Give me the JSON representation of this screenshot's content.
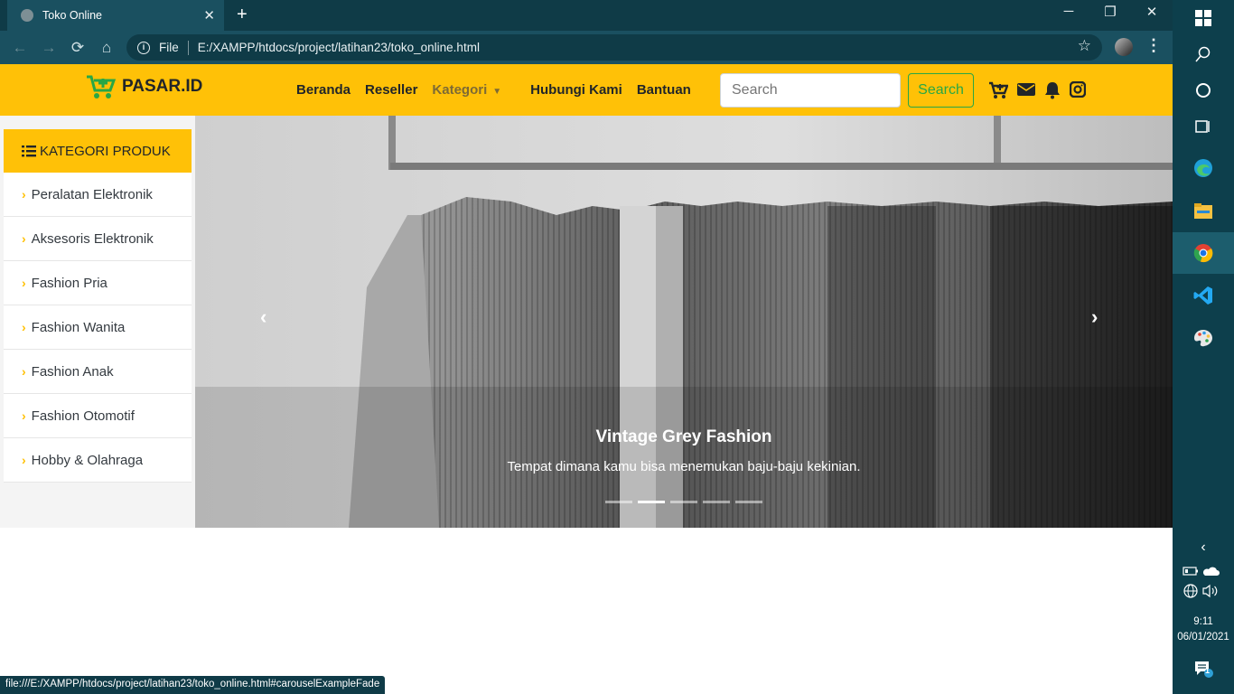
{
  "browser": {
    "tab_title": "Toko Online",
    "tab_close": "✕",
    "new_tab": "+",
    "window_controls": {
      "minimize": "─",
      "restore": "❐",
      "close": "✕"
    },
    "file_label": "File",
    "url": "E:/XAMPP/htdocs/project/latihan23/toko_online.html",
    "status_url": "file:///E:/XAMPP/htdocs/project/latihan23/toko_online.html#carouselExampleFade"
  },
  "navbar": {
    "brand": "PASAR.ID",
    "menu": [
      "Beranda",
      "Reseller",
      "Kategori",
      "Hubungi Kami",
      "Bantuan"
    ],
    "search_placeholder": "Search",
    "search_button": "Search",
    "icons": [
      "cart-plus-icon",
      "envelope-icon",
      "bell-icon",
      "instagram-icon"
    ]
  },
  "sidebar": {
    "heading": "KATEGORI PRODUK",
    "items": [
      "Peralatan Elektronik",
      "Aksesoris Elektronik",
      "Fashion Pria",
      "Fashion Wanita",
      "Fashion Anak",
      "Fashion Otomotif",
      "Hobby & Olahraga"
    ]
  },
  "carousel": {
    "caption_title": "Vintage Grey Fashion",
    "caption_text": "Tempat dimana kamu bisa menemukan baju-baju kekinian.",
    "slide_count": 5,
    "active_slide": 2,
    "prev": "‹",
    "next": "›"
  },
  "taskbar": {
    "time": "9:11",
    "date": "06/01/2021",
    "notification_count": "1",
    "pinned": [
      "windows-icon",
      "search-icon",
      "cortana-icon",
      "task-view-icon",
      "edge-icon",
      "file-explorer-icon",
      "chrome-icon",
      "vscode-icon",
      "paint-icon"
    ]
  },
  "colors": {
    "accent": "#ffc107",
    "chrome": "#1a5060",
    "success": "#28a745"
  }
}
